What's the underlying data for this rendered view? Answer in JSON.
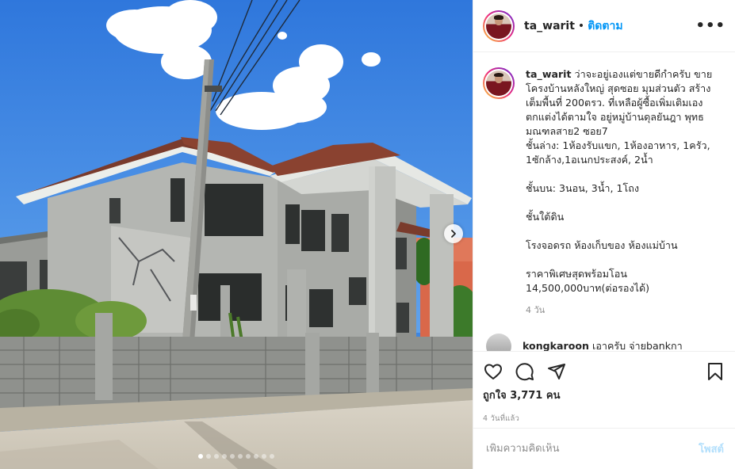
{
  "post": {
    "username": "ta_warit",
    "separator": "•",
    "follow_label": "ติดตาม",
    "more_icon": "more-options-icon",
    "caption_user": "ta_warit",
    "caption": "ว่าจะอยู่เองแต่ขายดีกำครับ ขายโครงบ้านหลังใหญ่ สุดซอย มุมส่วนตัว สร้างเต็มพื้นที่ 200ตรว. ที่เหลือผู้ซื้อเพิ่มเติมเอง ตกแต่งได้ตามใจ อยู่หมู่บ้านดุลยันฎา พุทธมณฑลสาย2 ซอย7\nชั้นล่าง: 1ห้องรับแขก, 1ห้องอาหาร, 1ครัว, 1ซักล้าง,1อเนกประสงค์, 2น้ำ\n\nชั้นบน: 3นอน, 3น้ำ, 1โถง\n\nชั้นใต้ดิน\n\nโรงจอดรถ ห้องเก็บของ ห้องแม่บ้าน\n\nราคาพิเศษสุดพร้อมโอน\n14,500,000บาท(ต่อรองได้)",
    "caption_time": "4 วัน",
    "comment_user": "kongkaroon",
    "comment_text": "เอาครับ จ่ายbankกา",
    "likes": "ถูกใจ 3,771 คน",
    "time_ago": "4 วันที่แล้ว",
    "add_comment_placeholder": "เพิ่มความคิดเห็น",
    "post_label": "โพสต์"
  },
  "carousel": {
    "total_slides": 10,
    "active_index": 0
  },
  "colors": {
    "accent": "#0095f6",
    "post_disabled": "#b2dffc",
    "muted": "#8e8e8e"
  }
}
